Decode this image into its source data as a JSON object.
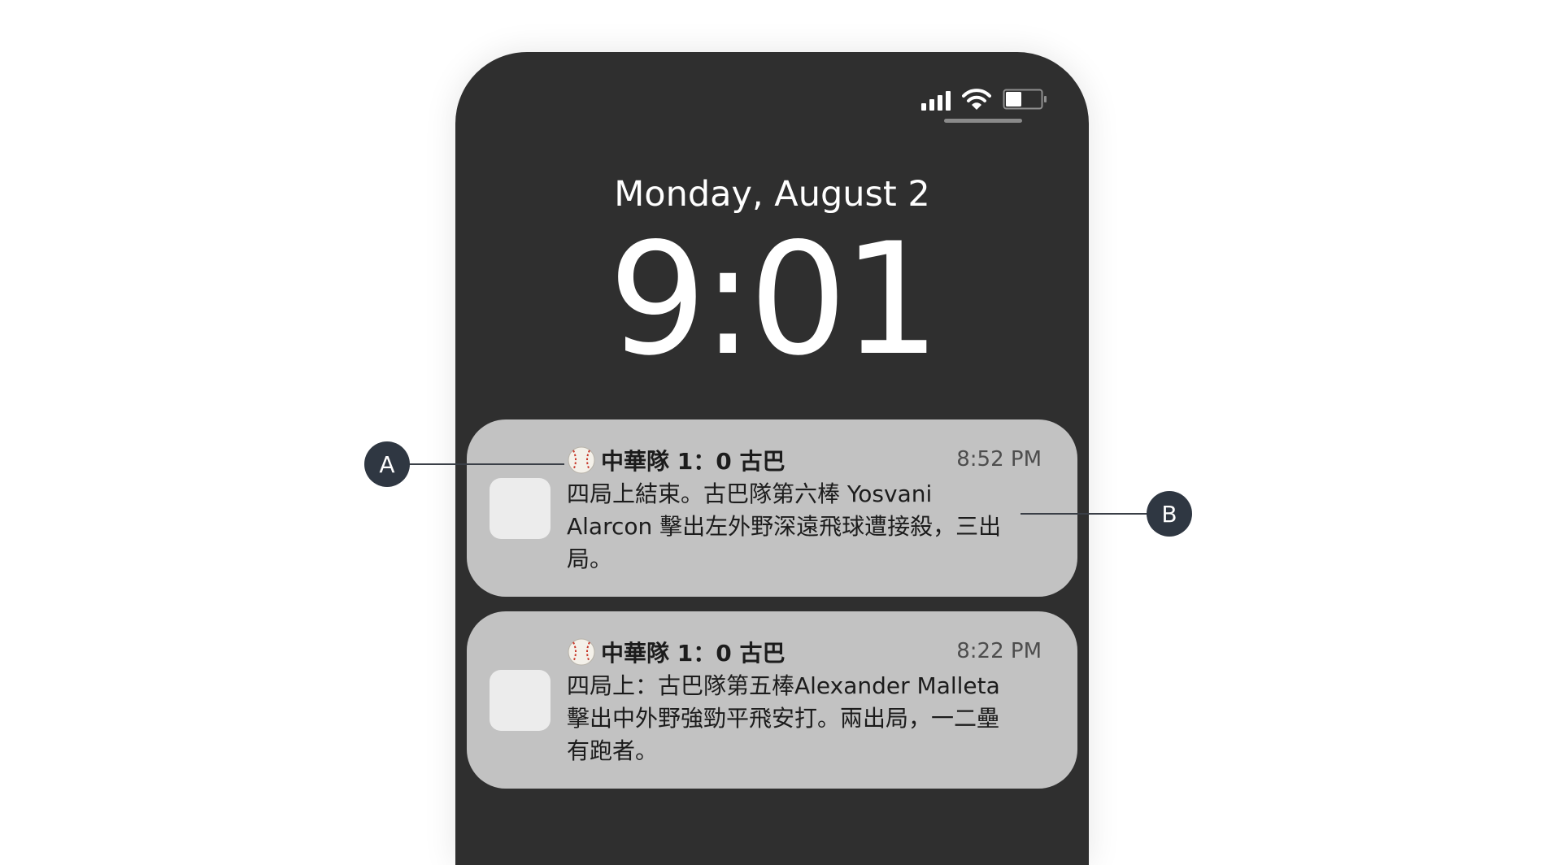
{
  "status_bar": {
    "signal_icon": "cellular-signal-icon",
    "wifi_icon": "wifi-icon",
    "battery_icon": "battery-icon",
    "battery_level": 0.45
  },
  "lock_screen": {
    "date": "Monday, August 2",
    "time": "9:01"
  },
  "notifications": [
    {
      "icon": "baseball-icon",
      "title": "中華隊 1：0 古巴",
      "time": "8:52 PM",
      "body": "四局上結束。古巴隊第六棒 Yosvani Alarcon 擊出左外野深遠飛球遭接殺，三出局。"
    },
    {
      "icon": "baseball-icon",
      "title": "中華隊 1：0 古巴",
      "time": "8:22 PM",
      "body": "四局上：古巴隊第五棒Alexander Malleta 擊出中外野強勁平飛安打。兩出局，一二壘有跑者。"
    }
  ],
  "callouts": {
    "a": "A",
    "b": "B"
  },
  "colors": {
    "phone_background": "#2f2f2f",
    "notification_background": "#c2c2c2",
    "callout_badge": "#2f3742"
  }
}
